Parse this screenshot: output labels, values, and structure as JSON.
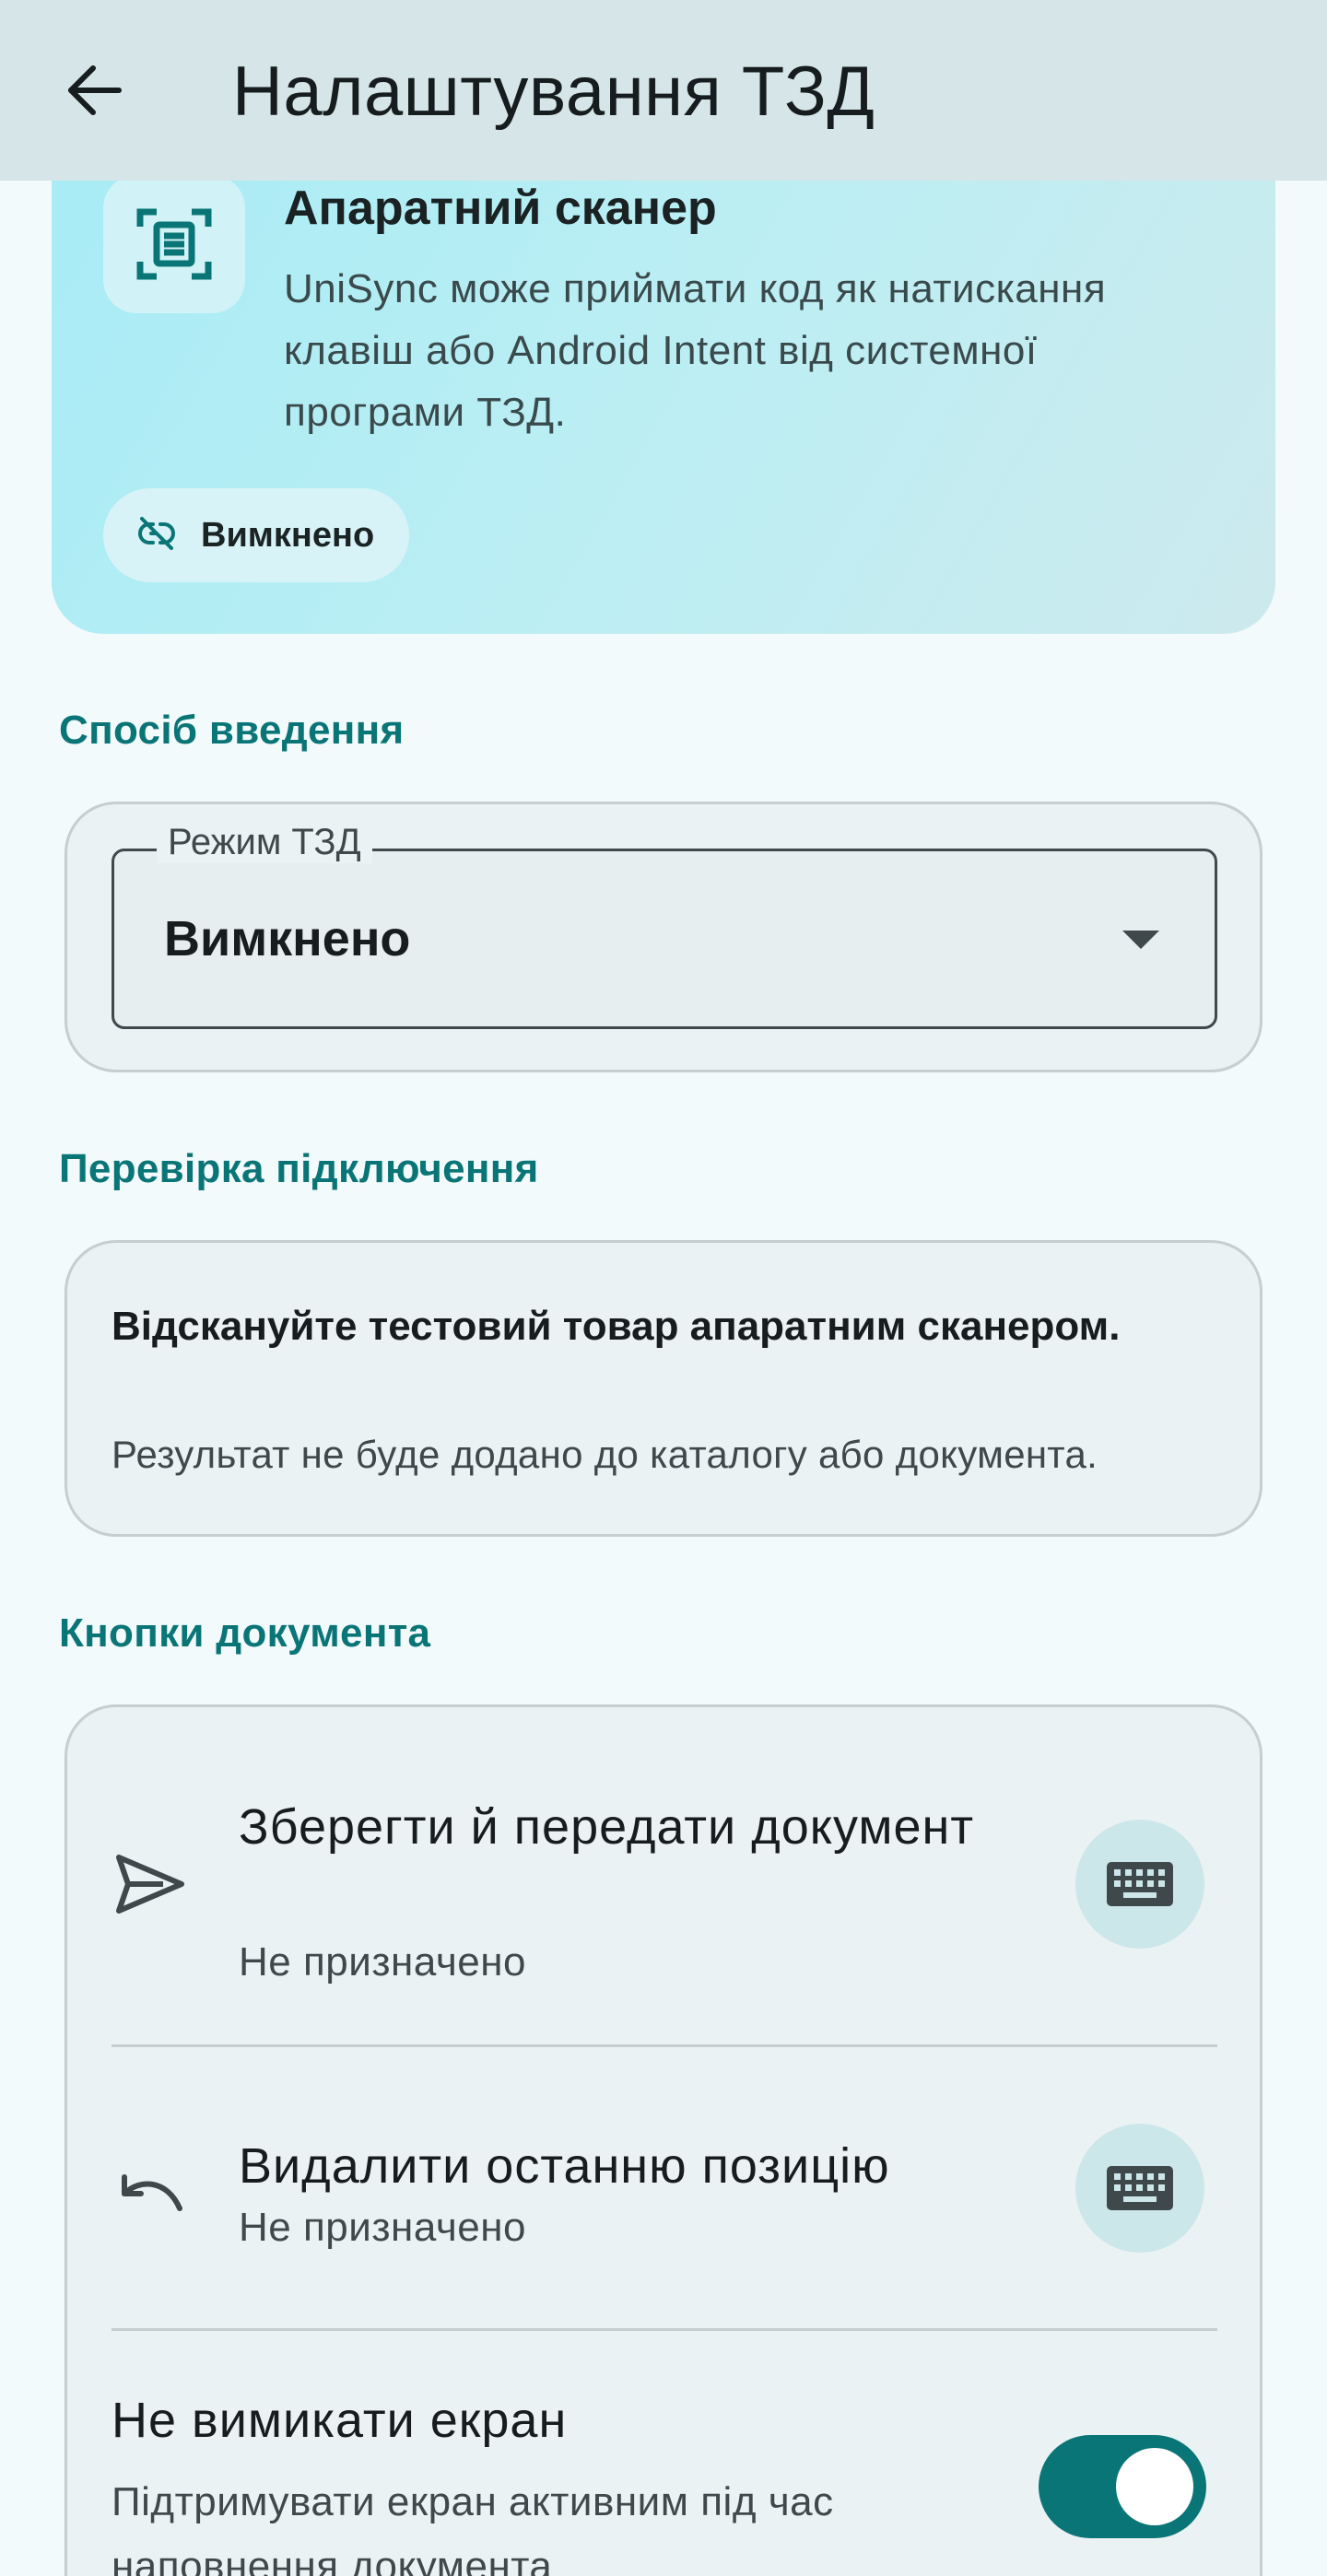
{
  "appbar": {
    "title": "Налаштування ТЗД",
    "back_icon": "arrow-back-icon"
  },
  "hero": {
    "icon": "barcode-scanner-icon",
    "title": "Апаратний сканер",
    "description": "UniSync може приймати код як натискання клавіш або Android Intent від системної програми ТЗД.",
    "status_icon": "link-off-icon",
    "status_label": "Вимкнено"
  },
  "input_section": {
    "title": "Спосіб введення",
    "mode_label": "Режим ТЗД",
    "mode_value": "Вимкнено"
  },
  "connection_section": {
    "title": "Перевірка підключення",
    "headline": "Відскануйте тестовий товар апаратним сканером.",
    "note": "Результат не буде додано до каталогу або документа."
  },
  "buttons_section": {
    "title": "Кнопки документа",
    "items": [
      {
        "icon": "send-icon",
        "title": "Зберегти й передати документ",
        "subtitle": "Не призначено",
        "action_icon": "keyboard-icon"
      },
      {
        "icon": "undo-icon",
        "title": "Видалити останню позицію",
        "subtitle": "Не призначено",
        "action_icon": "keyboard-icon"
      }
    ],
    "keep_screen": {
      "title": "Не вимикати екран",
      "subtitle": "Підтримувати екран активним під час наповнення документа",
      "enabled": true
    }
  },
  "colors": {
    "accent": "#0a7577",
    "appbar": "#d6e6e8",
    "background": "#f2fafb"
  }
}
